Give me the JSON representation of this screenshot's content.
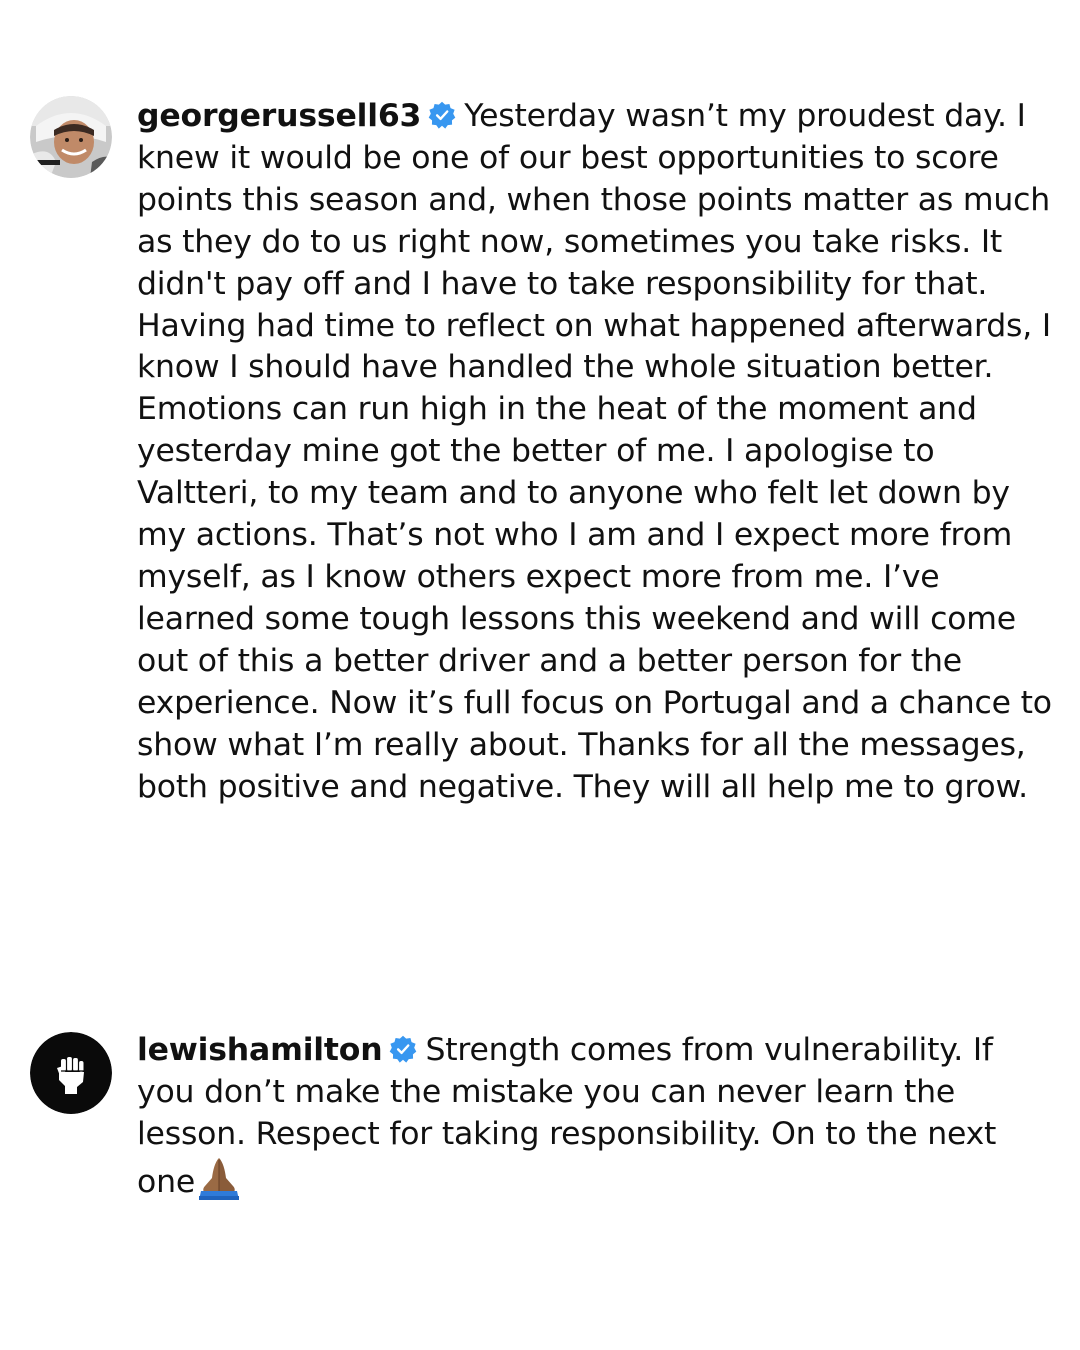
{
  "comments": [
    {
      "username": "georgerussell63",
      "verified": true,
      "avatar": "profile-photo-driver-helmet",
      "text": "Yesterday wasn’t my proudest day. I knew it would be one of our best opportunities to score points this season and, when those points matter as much as they do to us right now, sometimes you take risks. It didn't pay off and I have to take responsibility for that. Having had time to reflect on what happened afterwards, I know I should have handled the whole situation better. Emotions can run high in the heat of the moment and yesterday mine got the better of me. I apologise to Valtteri, to my team and to anyone who felt let down by my actions. That’s not who I am and I expect more from myself, as I know others expect more from me. I’ve learned some tough lessons this weekend and will come out of this a better driver and a better person for the experience. Now it’s full focus on Portugal and a chance to show what I’m really about. Thanks for all the messages, both positive and negative. They will all help me to grow."
    },
    {
      "username": "lewishamilton",
      "verified": true,
      "avatar": "raised-fist-icon",
      "text": "Strength comes from vulnerability. If you don’t make the mistake you can never learn the lesson. Respect for taking responsibility. On to the next one",
      "emoji": "folded-hands-emoji"
    }
  ],
  "colors": {
    "verified_badge": "#3897f0",
    "text": "#111111",
    "background": "#ffffff"
  }
}
